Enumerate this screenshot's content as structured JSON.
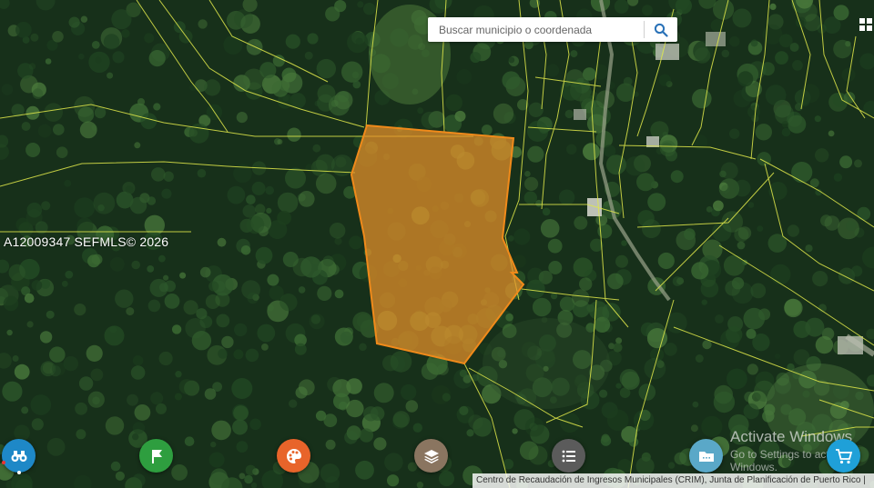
{
  "search": {
    "placeholder": "Buscar municipio o coordenada"
  },
  "watermark": "A12009347  SEFMLS© 2026",
  "os_overlay": {
    "title": "Activate Windows",
    "subtitle": "Go to Settings to activate Windows."
  },
  "attribution": "Centro de Recaudación de Ingresos Municipales (CRIM), Junta de Planificación de Puerto Rico |",
  "toolbar": [
    {
      "id": "explore",
      "icon": "binoculars-icon",
      "color": "#1e88c7"
    },
    {
      "id": "flag",
      "icon": "flag-icon",
      "color": "#2e9e3f"
    },
    {
      "id": "theme",
      "icon": "palette-icon",
      "color": "#e8642a"
    },
    {
      "id": "layers",
      "icon": "layers-icon",
      "color": "#8a7560"
    },
    {
      "id": "legend",
      "icon": "list-icon",
      "color": "#5b5b5b"
    },
    {
      "id": "files",
      "icon": "folder-icon",
      "color": "#5aa8c8"
    },
    {
      "id": "cart",
      "icon": "cart-icon",
      "color": "#1fa0d8"
    }
  ],
  "colors": {
    "parcel_fill": "#e8922a",
    "parcel_stroke": "#f08a1a",
    "parcel_lines": "#e0e84a"
  }
}
